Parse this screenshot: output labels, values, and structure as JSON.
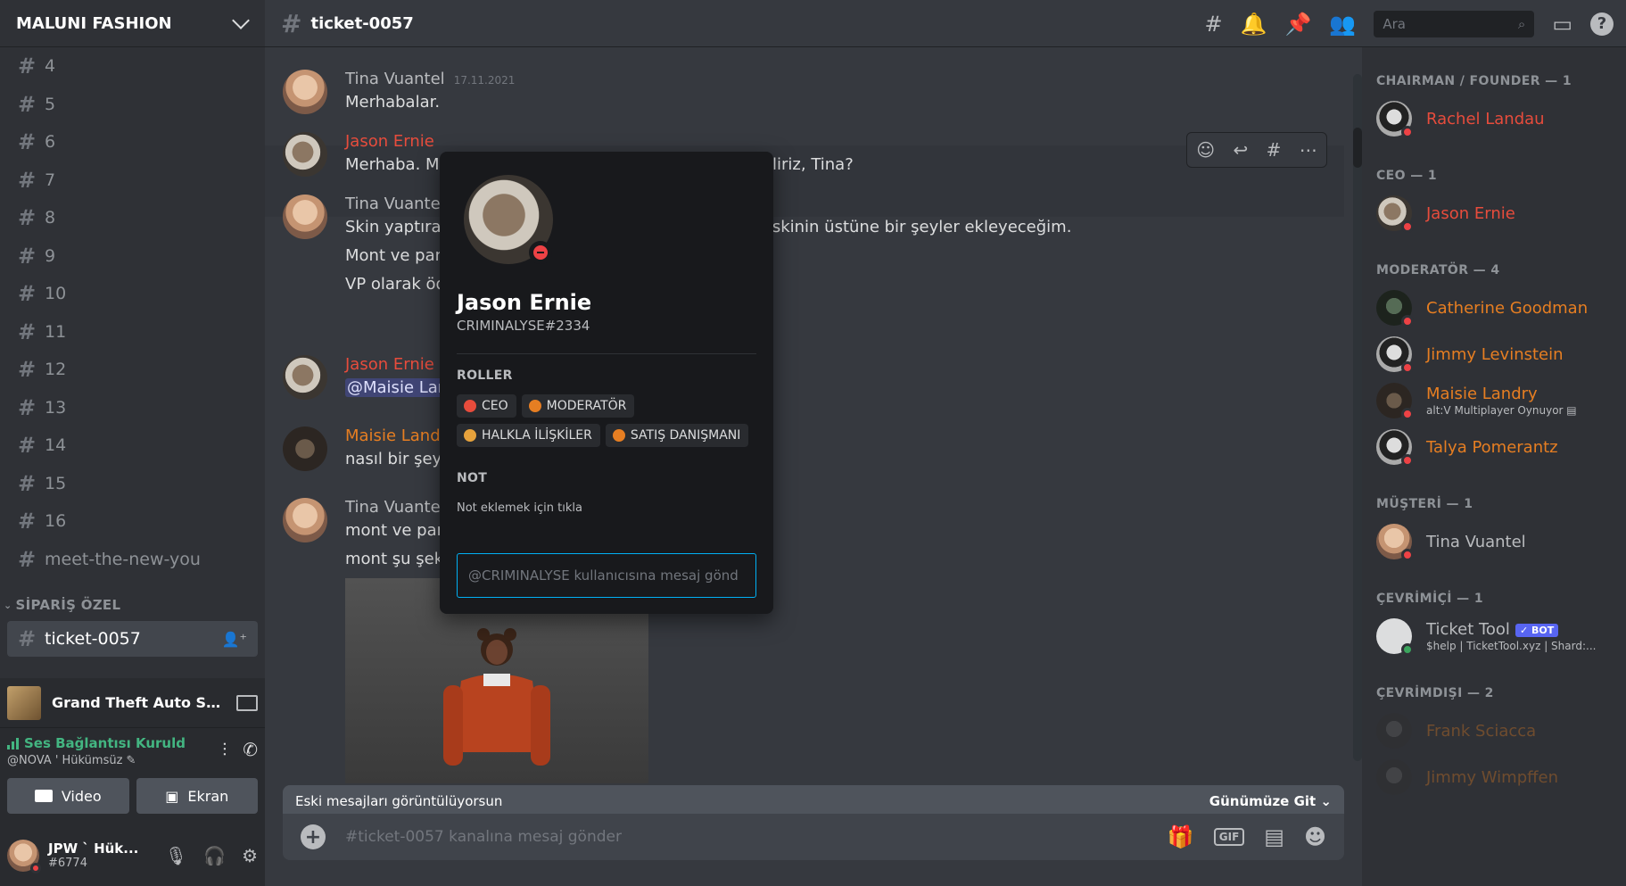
{
  "server": {
    "name": "MALUNI FASHION"
  },
  "channels": [
    "4",
    "5",
    "6",
    "7",
    "8",
    "9",
    "10",
    "11",
    "12",
    "13",
    "14",
    "15",
    "16",
    "meet-the-new-you"
  ],
  "category": {
    "name": "SİPARİŞ ÖZEL",
    "active_channel": "ticket-0057"
  },
  "activity": {
    "game": "Grand Theft Auto San..."
  },
  "voice": {
    "status": "Ses Bağlantısı Kuruld",
    "sub": "@NOVA ' Hükümsüz ✎",
    "video_label": "Video",
    "screen_label": "Ekran"
  },
  "user": {
    "name": "JPW ` Hük...",
    "tag": "#6774"
  },
  "topbar": {
    "channel": "ticket-0057",
    "search_placeholder": "Ara",
    "help": "?"
  },
  "messages": [
    {
      "author": "Tina Vuantel",
      "time": "17.11.2021",
      "lines": [
        "Merhabalar."
      ]
    },
    {
      "author": "Jason Ernie",
      "lines": [
        "Merhaba. M",
        "olabiliriz, Tina?"
      ]
    },
    {
      "author": "Tina Vuante",
      "lines": [
        "Skin yaptırac",
        ". O skinin üstüne bir şeyler ekleyeceğim.",
        "Mont ve pan",
        "VP olarak öd"
      ]
    },
    {
      "author": "Jason Ernie",
      "lines": [
        "@Maisie Lar"
      ]
    },
    {
      "author": "Maisie Landr",
      "lines": [
        "nasıl bir şey"
      ]
    },
    {
      "author": "Tina Vuante",
      "lines": [
        "mont ve pan",
        "mont şu şeki"
      ]
    }
  ],
  "bottom": {
    "old_messages": "Eski mesajları görüntülüyorsun",
    "jump": "Günümüze Git",
    "composer_placeholder": "#ticket-0057 kanalına mesaj gönder",
    "gif": "GIF",
    "plus": "+"
  },
  "members": {
    "groups": [
      {
        "header": "CHAIRMAN / FOUNDER — 1",
        "members": [
          {
            "name": "Rachel Landau",
            "color": "#e74c3c",
            "status": ""
          }
        ]
      },
      {
        "header": "CEO — 1",
        "members": [
          {
            "name": "Jason Ernie",
            "color": "#e74c3c",
            "status": ""
          }
        ]
      },
      {
        "header": "MODERATÖR — 4",
        "members": [
          {
            "name": "Catherine Goodman",
            "color": "#e67e22",
            "status": ""
          },
          {
            "name": "Jimmy Levinstein",
            "color": "#e67e22",
            "status": ""
          },
          {
            "name": "Maisie Landry",
            "color": "#e67e22",
            "status": "alt:V Multiplayer Oynuyor"
          },
          {
            "name": "Talya Pomerantz",
            "color": "#e67e22",
            "status": ""
          }
        ]
      },
      {
        "header": "MÜŞTERİ — 1",
        "members": [
          {
            "name": "Tina Vuantel",
            "color": "#b9bbbe",
            "status": ""
          }
        ]
      },
      {
        "header": "ÇEVRİMİÇİ — 1",
        "members": [
          {
            "name": "Ticket Tool",
            "color": "#b9bbbe",
            "status": "$help | TicketTool.xyz | Shard:..."
          }
        ]
      },
      {
        "header": "ÇEVRİMDIŞI — 2",
        "members": [
          {
            "name": "Frank Sciacca",
            "color": "#e67e22",
            "status": ""
          },
          {
            "name": "Jimmy Wimpffen",
            "color": "#e67e22",
            "status": ""
          }
        ]
      }
    ],
    "bot_tag": "✓ BOT"
  },
  "popout": {
    "name": "Jason Ernie",
    "tag": "CRIMINALYSE#2334",
    "roles_header": "ROLLER",
    "roles": [
      {
        "name": "CEO",
        "color": "#e74c3c"
      },
      {
        "name": "MODERATÖR",
        "color": "#e67e22"
      },
      {
        "name": "HALKLA İLİŞKİLER",
        "color": "#e6a23c"
      },
      {
        "name": "SATIŞ DANIŞMANI",
        "color": "#e67e22"
      }
    ],
    "note_header": "NOT",
    "note_placeholder": "Not eklemek için tıkla",
    "dm_placeholder": "@CRIMINALYSE kullanıcısına mesaj gönd"
  },
  "colors": {
    "accent": "#5865f2",
    "dnd": "#ed4245",
    "online": "#3ba55d",
    "voice": "#43b581"
  }
}
